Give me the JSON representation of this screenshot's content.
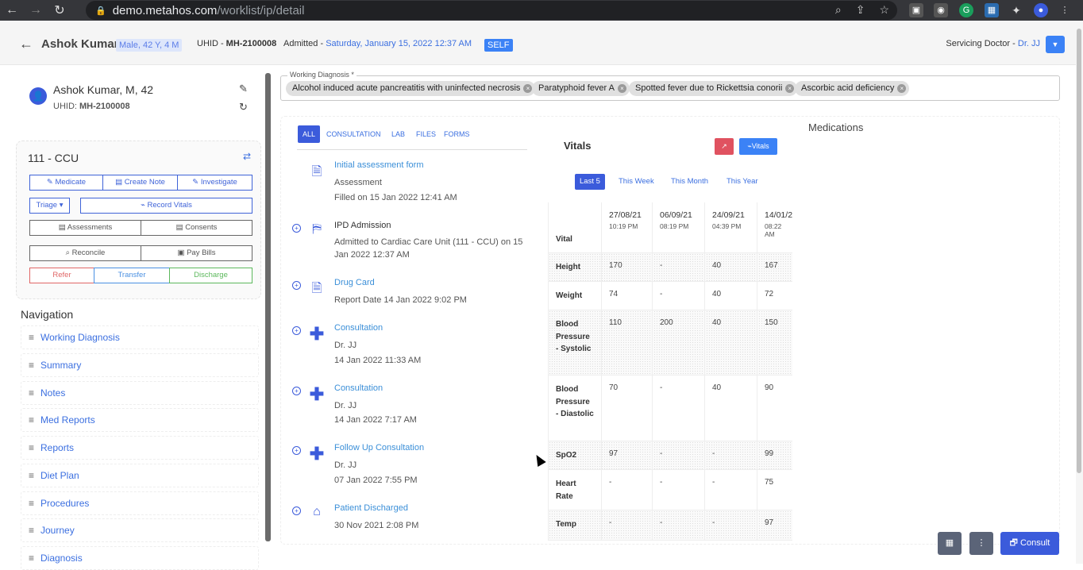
{
  "browser": {
    "url_host": "demo.metahos.com",
    "url_path": "/worklist/ip/detail"
  },
  "header": {
    "patient_name": "Ashok Kumar",
    "demographics": "Male, 42 Y, 4 M",
    "uhid_label": "UHID - ",
    "uhid": "MH-2100008",
    "admitted_label": "Admitted - ",
    "admitted_date": "Saturday, January 15, 2022 12:37 AM",
    "payer": "SELF",
    "servicing_label": "Servicing Doctor - ",
    "servicing_doctor": "Dr. JJ"
  },
  "patient_card": {
    "name_line": "Ashok Kumar, M, 42",
    "uhid_label": "UHID: ",
    "uhid": "MH-2100008",
    "ward": "111 - CCU",
    "actions": {
      "medicate": "Medicate",
      "create_note": "Create Note",
      "investigate": "Investigate",
      "triage": "Triage",
      "record_vitals": "Record Vitals",
      "assessments": "Assessments",
      "consents": "Consents",
      "reconcile": "Reconcile",
      "pay_bills": "Pay Bills",
      "refer": "Refer",
      "transfer": "Transfer",
      "discharge": "Discharge"
    }
  },
  "navigation": {
    "title": "Navigation",
    "items": [
      "Working Diagnosis",
      "Summary",
      "Notes",
      "Med Reports",
      "Reports",
      "Diet Plan",
      "Procedures",
      "Journey",
      "Diagnosis"
    ]
  },
  "working_diagnosis": {
    "label": "Working Diagnosis *",
    "chips": [
      "Alcohol induced acute pancreatitis with uninfected necrosis",
      "Paratyphoid fever A",
      "Spotted fever due to Rickettsia conorii",
      "Ascorbic acid deficiency"
    ]
  },
  "timeline_tabs": [
    "ALL",
    "CONSULTATION",
    "LAB",
    "FILES",
    "FORMS"
  ],
  "timeline": [
    {
      "title": "Initial assessment form",
      "line1": "Assessment",
      "line2": "Filled on 15 Jan 2022 12:41 AM"
    },
    {
      "title": "IPD Admission",
      "line1": "Admitted to Cardiac Care Unit (111 - CCU) on 15 Jan 2022 12:37 AM",
      "line2": ""
    },
    {
      "title": "Drug Card",
      "line1": "Report Date 14 Jan 2022 9:02 PM",
      "line2": ""
    },
    {
      "title": "Consultation",
      "line1": "Dr. JJ",
      "line2": "14 Jan 2022 11:33 AM"
    },
    {
      "title": "Consultation",
      "line1": "Dr. JJ",
      "line2": "14 Jan 2022 7:17 AM"
    },
    {
      "title": "Follow Up Consultation",
      "line1": "Dr. JJ",
      "line2": "07 Jan 2022 7:55 PM"
    },
    {
      "title": "Patient Discharged",
      "line1": "30 Nov 2021 2:08 PM",
      "line2": ""
    }
  ],
  "vitals": {
    "title": "Vitals",
    "vitals_button": "Vitals",
    "periods": [
      "Last 5",
      "This Week",
      "This Month",
      "This Year"
    ],
    "header_label": "Vital",
    "columns": [
      {
        "date": "27/08/21",
        "time": "10:19 PM"
      },
      {
        "date": "06/09/21",
        "time": "08:19 PM"
      },
      {
        "date": "24/09/21",
        "time": "04:39 PM"
      },
      {
        "date": "14/01/2",
        "time": "08:22 AM"
      }
    ],
    "rows": [
      {
        "name": "Height",
        "values": [
          "170",
          "-",
          "40",
          "167"
        ]
      },
      {
        "name": "Weight",
        "values": [
          "74",
          "-",
          "40",
          "72"
        ]
      },
      {
        "name": "Blood Pressure - Systolic",
        "values": [
          "110",
          "200",
          "40",
          "150"
        ]
      },
      {
        "name": "Blood Pressure - Diastolic",
        "values": [
          "70",
          "-",
          "40",
          "90"
        ]
      },
      {
        "name": "SpO2",
        "values": [
          "97",
          "-",
          "-",
          "99"
        ]
      },
      {
        "name": "Heart Rate",
        "values": [
          "-",
          "-",
          "-",
          "75"
        ]
      },
      {
        "name": "Temp",
        "values": [
          "-",
          "-",
          "-",
          "97"
        ]
      }
    ]
  },
  "medications": {
    "title": "Medications"
  },
  "footer": {
    "consult": "Consult"
  },
  "colors": {
    "primary": "#3b5bdb",
    "link": "#3b8fd8",
    "danger": "#e05260",
    "success": "#5cb85c"
  }
}
